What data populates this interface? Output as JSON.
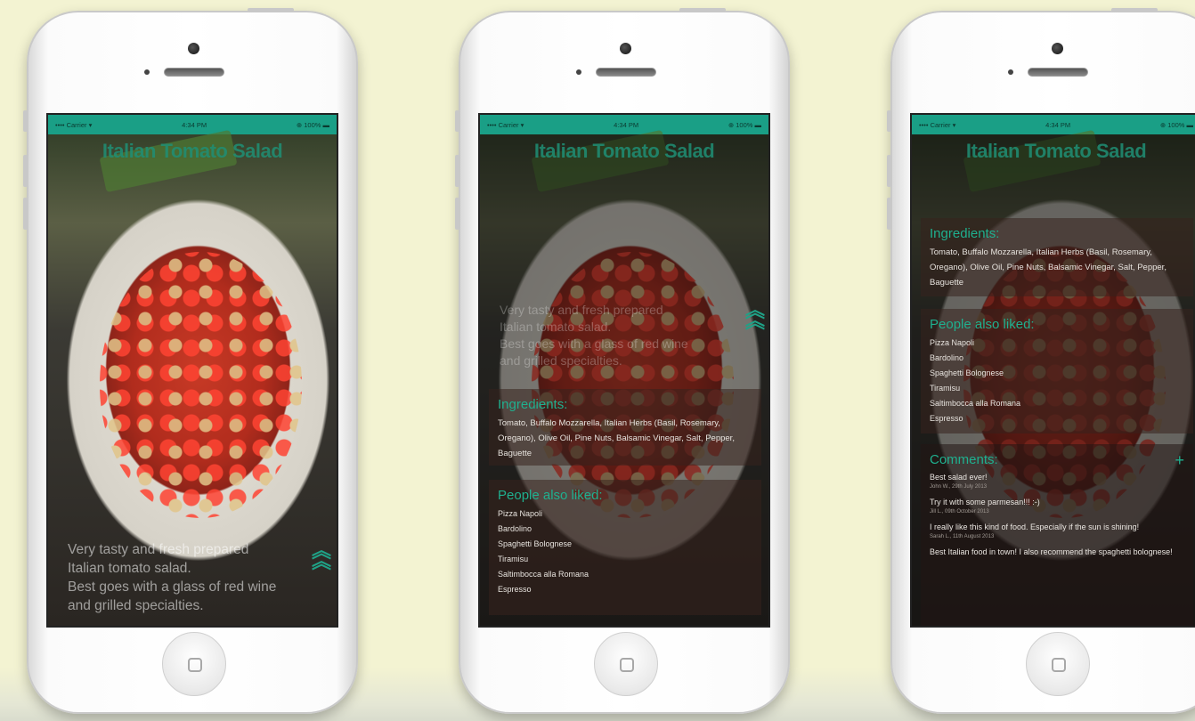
{
  "status_bar": {
    "carrier": "•••• Carrier ▾",
    "time": "4:34 PM",
    "battery": "⊕ 100% ▬"
  },
  "recipe": {
    "title": "Italian Tomato Salad",
    "description_lines": [
      "Very tasty and fresh prepared",
      "Italian tomato salad.",
      "Best goes with a glass of red wine",
      "and grilled specialties."
    ],
    "description_lines_p1": [
      "Very tasty and fresh prepared",
      "Italian tomato salad.",
      "Best goes with a glass of red wine",
      "and grilled specialties."
    ],
    "expand_icon": "double-chevron-up-icon"
  },
  "ingredients": {
    "heading": "Ingredients:",
    "text": "Tomato, Buffalo Mozzarella, Italian Herbs (Basil, Rosemary, Oregano), Olive Oil, Pine Nuts, Balsamic Vinegar, Salt, Pepper, Baguette"
  },
  "people_also_liked": {
    "heading": "People also liked:",
    "items": [
      "Pizza Napoli",
      "Bardolino",
      "Spaghetti Bolognese",
      "Tiramisu",
      "Saltimbocca alla Romana",
      "Espresso"
    ]
  },
  "comments": {
    "heading": "Comments:",
    "add_icon": "+",
    "items": [
      {
        "text": "Best salad ever!",
        "meta": "John W., 29th July 2013"
      },
      {
        "text": "Try it with some parmesan!!! :-)",
        "meta": "Jill L., 09th October 2013"
      },
      {
        "text": "I really like this kind of food. Especially if the sun is shining!",
        "meta": "Sarah L., 11th August 2013"
      },
      {
        "text": "Best Italian food in town! I also recommend the spaghetti bolognese!",
        "meta": ""
      }
    ]
  },
  "colors": {
    "accent": "#1fa287",
    "status_bar": "#1a9f86",
    "background": "#f3f3d2"
  }
}
